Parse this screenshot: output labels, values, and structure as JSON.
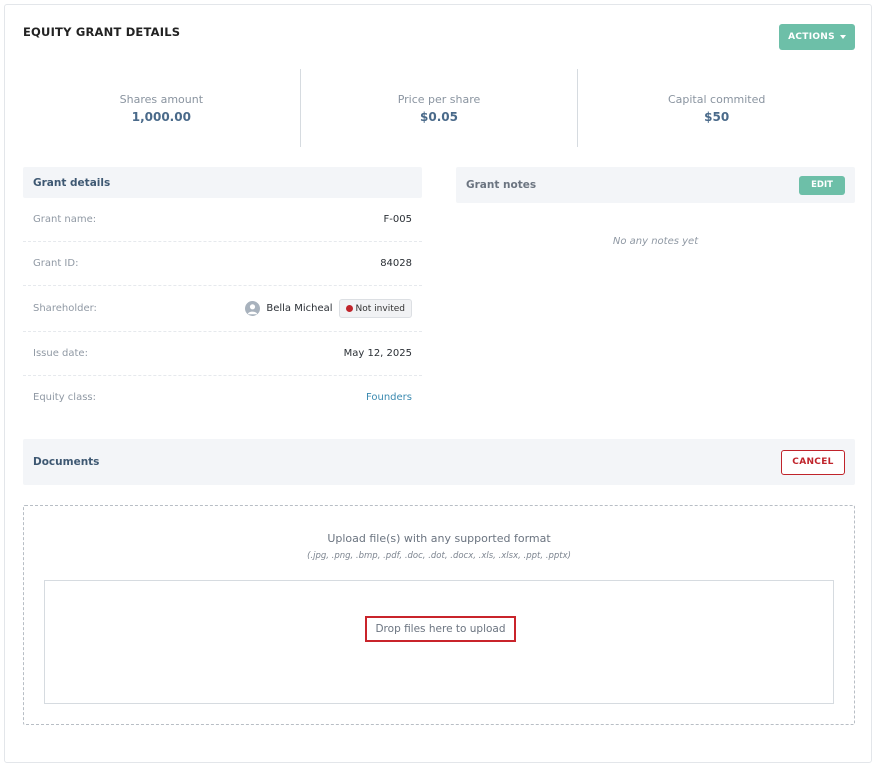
{
  "page": {
    "title": "EQUITY GRANT DETAILS",
    "actions_label": "ACTIONS"
  },
  "stats": [
    {
      "label": "Shares amount",
      "value": "1,000.00"
    },
    {
      "label": "Price per share",
      "value": "$0.05"
    },
    {
      "label": "Capital commited",
      "value": "$50"
    }
  ],
  "grant_details": {
    "title": "Grant details",
    "rows": {
      "grant_name": {
        "label": "Grant name:",
        "value": "F-005"
      },
      "grant_id": {
        "label": "Grant ID:",
        "value": "84028"
      },
      "shareholder": {
        "label": "Shareholder:",
        "name": "Bella Micheal",
        "status": "Not invited",
        "status_color": "#c0242b"
      },
      "issue_date": {
        "label": "Issue date:",
        "value": "May 12, 2025"
      },
      "equity_class": {
        "label": "Equity class:",
        "value": "Founders"
      }
    }
  },
  "grant_notes": {
    "title": "Grant notes",
    "edit_label": "EDIT",
    "empty_text": "No any notes yet"
  },
  "documents": {
    "title": "Documents",
    "cancel_label": "CANCEL",
    "upload_title": "Upload file(s) with any supported format",
    "upload_formats": "(.jpg, .png, .bmp, .pdf, .doc, .dot, .docx, .xls, .xlsx, .ppt, .pptx)",
    "drop_label": "Drop files here to upload"
  },
  "colors": {
    "accent": "#6dbfa8",
    "danger": "#c0242b",
    "link": "#3b8ab0"
  }
}
